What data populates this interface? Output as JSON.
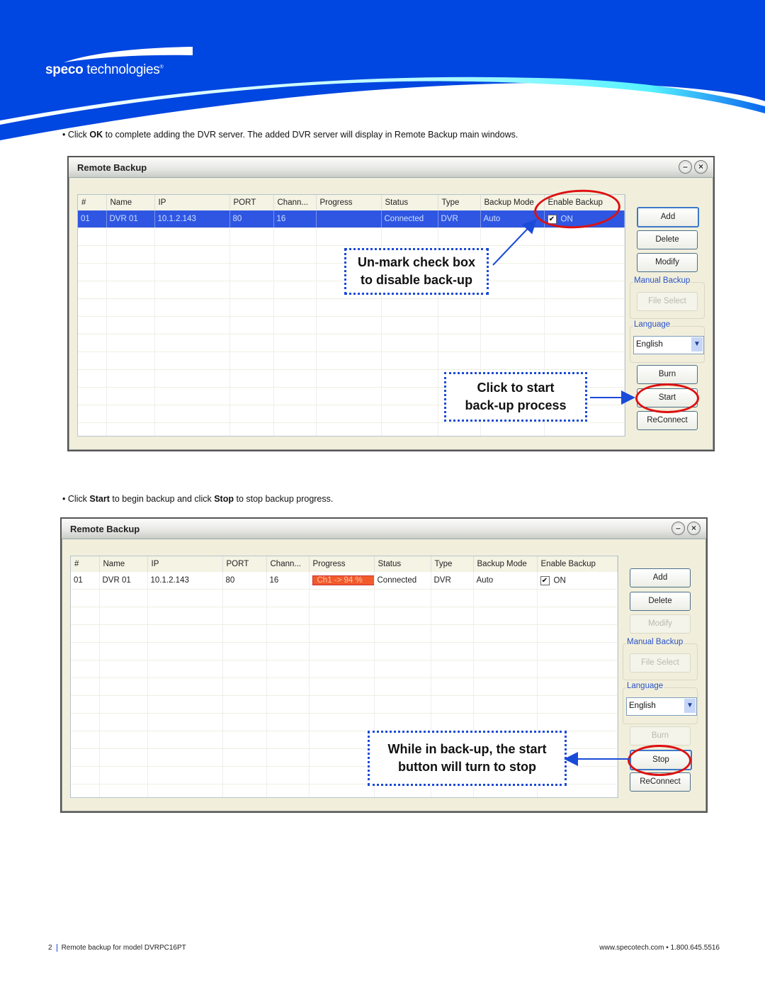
{
  "brand": {
    "name_bold": "speco",
    "name_rest": " technologies",
    "registered": "®",
    "primary_color": "#0044dd",
    "accent_color": "#66ffff"
  },
  "instructions": [
    {
      "prefix": "• Click ",
      "keyword": "OK",
      "suffix": " to complete adding the DVR server. The added DVR server will display in Remote Backup main windows."
    },
    {
      "prefix": "• Click ",
      "keyword": "Start",
      "middle": " to begin backup and click ",
      "keyword2": "Stop",
      "suffix": " to stop backup progress."
    }
  ],
  "window_title_bar_icons": [
    "minimize-icon",
    "close-icon"
  ],
  "columns": [
    "#",
    "Name",
    "IP",
    "PORT",
    "Chann...",
    "Progress",
    "Status",
    "Type",
    "Backup Mode",
    "Enable Backup"
  ],
  "screenshots": [
    {
      "title": "Remote Backup",
      "row": {
        "num": "01",
        "name": "DVR 01",
        "ip": "10.1.2.143",
        "port": "80",
        "channels": "16",
        "progress": "",
        "status": "Connected",
        "type": "DVR",
        "mode": "Auto",
        "enabled": true,
        "enable_label": "ON",
        "selected": true
      },
      "buttons": {
        "add": "Add",
        "delete": "Delete",
        "modify": "Modify",
        "file_select": "File Select",
        "burn": "Burn",
        "action": "Start",
        "reconnect": "ReConnect"
      },
      "disabled": [
        "file_select"
      ],
      "groups": {
        "manual_backup": "Manual Backup",
        "language": "Language"
      },
      "language_value": "English",
      "callouts": [
        "Un-mark check box\nto disable back-up",
        "Click to start\nback-up process"
      ]
    },
    {
      "title": "Remote Backup",
      "row": {
        "num": "01",
        "name": "DVR 01",
        "ip": "10.1.2.143",
        "port": "80",
        "channels": "16",
        "progress": "Ch1 -> 94 %",
        "progress_percent": 94,
        "status": "Connected",
        "type": "DVR",
        "mode": "Auto",
        "enabled": true,
        "enable_label": "ON",
        "selected": false
      },
      "buttons": {
        "add": "Add",
        "delete": "Delete",
        "modify": "Modify",
        "file_select": "File Select",
        "burn": "Burn",
        "action": "Stop",
        "reconnect": "ReConnect"
      },
      "disabled": [
        "modify",
        "file_select",
        "burn"
      ],
      "groups": {
        "manual_backup": "Manual Backup",
        "language": "Language"
      },
      "language_value": "English",
      "callouts": [
        "While in back-up, the start\nbutton will turn to stop"
      ]
    }
  ],
  "footer": {
    "page": "2",
    "doc_title": "Remote backup for model DVRPC16PT",
    "contact": "www.specotech.com • 1.800.645.5516"
  }
}
